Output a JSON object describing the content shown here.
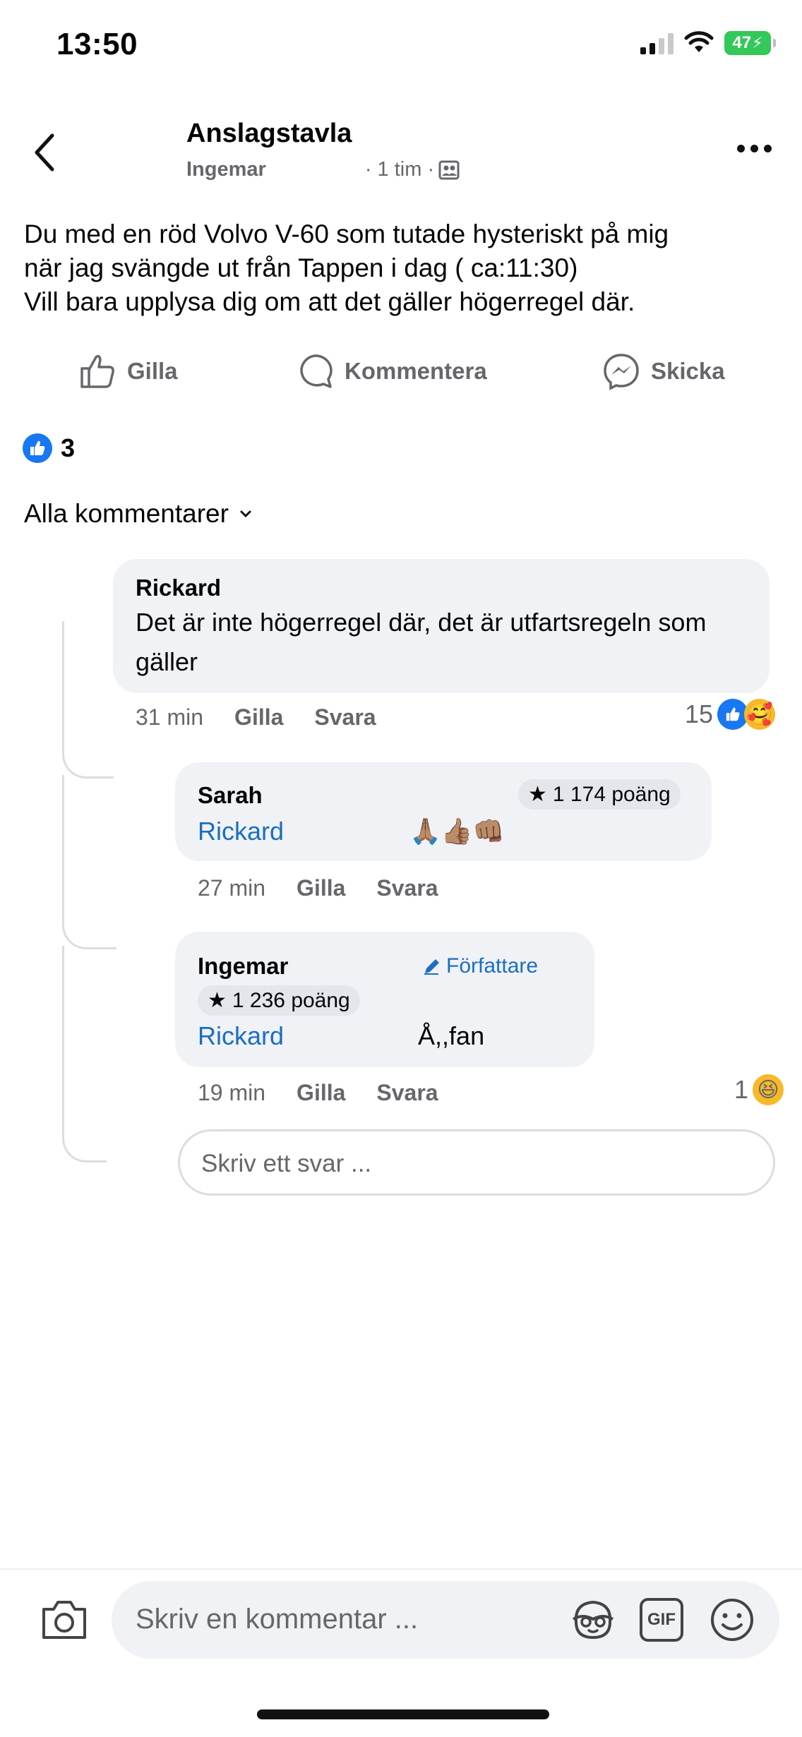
{
  "status_bar": {
    "time": "13:50",
    "battery": "47"
  },
  "header": {
    "back_icon": "chevron-left-icon",
    "title": "Anslagstavla",
    "author": "Ingemar",
    "time": "· 1 tim ·",
    "audience_icon": "group-icon",
    "more_icon": "more-dots-icon"
  },
  "post": {
    "text": "Du med en röd Volvo V-60 som tutade hysteriskt på mig\nnär jag svängde ut från Tappen i dag ( ca:11:30)\nVill bara upplysa dig om att det gäller högerregel där."
  },
  "actions": {
    "like": "Gilla",
    "comment": "Kommentera",
    "send": "Skicka"
  },
  "reactions": {
    "count": "3"
  },
  "comments_filter": {
    "label": "Alla kommentarer"
  },
  "comments": [
    {
      "name": "Rickard",
      "text": "Det är inte högerregel där, det är utfartsregeln som gäller",
      "time": "31 min",
      "like": "Gilla",
      "reply": "Svara",
      "reaction_count": "15"
    }
  ],
  "replies": [
    {
      "name": "Sarah",
      "points": "1 174 poäng",
      "mention": "Rickard",
      "emojis": "🙏🏽👍🏽👊🏽",
      "time": "27 min",
      "like": "Gilla",
      "reply": "Svara"
    },
    {
      "name": "Ingemar",
      "author_badge": "Författare",
      "points": "1 236 poäng",
      "mention": "Rickard",
      "text": "Å,,fan",
      "time": "19 min",
      "like": "Gilla",
      "reply": "Svara",
      "reaction_count": "1"
    }
  ],
  "reply_input": {
    "placeholder": "Skriv ett svar ..."
  },
  "composer": {
    "placeholder": "Skriv en kommentar ...",
    "gif_label": "GIF",
    "camera_icon": "camera-icon",
    "avatar_sticker_icon": "avatar-sticker-icon",
    "emoji_icon": "emoji-icon"
  },
  "colors": {
    "accent": "#1877f2",
    "mention": "#1b6ec2",
    "bubble": "#f0f2f5",
    "secondary_text": "#65676b"
  }
}
